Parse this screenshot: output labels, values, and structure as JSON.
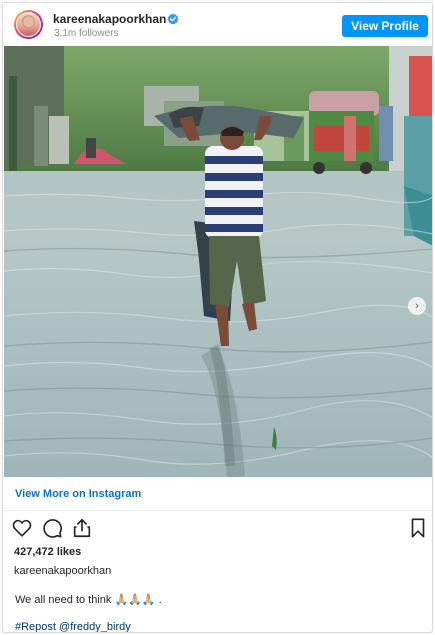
{
  "header": {
    "username": "kareenakapoorkhan",
    "followers": "3.1m followers",
    "view_profile": "View Profile"
  },
  "post": {
    "view_more": "View More on Instagram",
    "likes": "427,472 likes",
    "caption_user": "kareenakapoorkhan",
    "caption_text": "We all need to think 🙏🏼🙏🏼🙏🏼 .",
    "hashtag": "#Repost @freddy_birdy"
  },
  "icons": {
    "verified": "verified-badge-icon",
    "like": "heart-icon",
    "comment": "comment-icon",
    "share": "share-icon",
    "save": "bookmark-icon",
    "next": "chevron-right-icon"
  },
  "colors": {
    "accent": "#0095f6",
    "link": "#0a72c5"
  }
}
